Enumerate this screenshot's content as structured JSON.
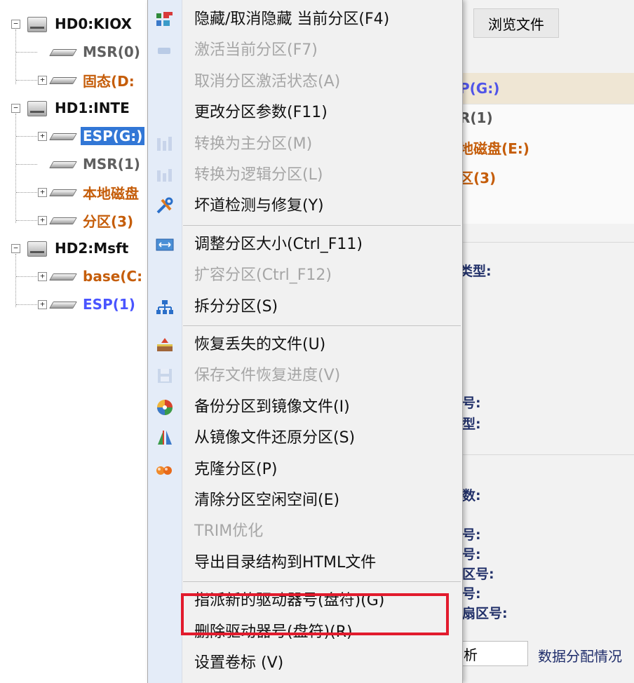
{
  "tree": {
    "nodes": [
      {
        "label": "HD0:KIOX",
        "type": "disk",
        "expander": "−",
        "color": "black"
      },
      {
        "label": "MSR(0)",
        "type": "partition",
        "color": "gray"
      },
      {
        "label": "固态(D:",
        "type": "partition",
        "expander": "+",
        "color": "orange"
      },
      {
        "label": "HD1:INTE",
        "type": "disk",
        "expander": "−",
        "color": "black"
      },
      {
        "label": "ESP(G:)",
        "type": "partition",
        "expander": "+",
        "color": "selected"
      },
      {
        "label": "MSR(1)",
        "type": "partition",
        "color": "gray"
      },
      {
        "label": "本地磁盘",
        "type": "partition",
        "expander": "+",
        "color": "orange"
      },
      {
        "label": "分区(3)",
        "type": "partition",
        "expander": "+",
        "color": "orange"
      },
      {
        "label": "HD2:Msft",
        "type": "disk",
        "expander": "−",
        "color": "black"
      },
      {
        "label": "base(C:",
        "type": "partition",
        "expander": "+",
        "color": "orange"
      },
      {
        "label": "ESP(1)",
        "type": "partition",
        "expander": "+",
        "color": "blue"
      }
    ]
  },
  "right_panel": {
    "tab_label": "浏览文件",
    "rows": [
      {
        "label": "P(G:)",
        "color": "#5054e8"
      },
      {
        "label": "R(1)",
        "color": "#555555"
      },
      {
        "label": "地磁盘(E:)",
        "color": "#c55d0a"
      },
      {
        "label": "区(3)",
        "color": "#c55d0a"
      }
    ],
    "fields": [
      "类型:",
      "号:",
      "型:",
      "数:",
      "号:",
      "号:",
      "区号:",
      "号:",
      "扇区号:"
    ],
    "input_value": "析",
    "trailing_text": "数据分配情况"
  },
  "context_menu": {
    "items": [
      {
        "label": "隐藏/取消隐藏 当前分区(F4)",
        "icon": "hide-partition-icon",
        "enabled": true
      },
      {
        "label": "激活当前分区(F7)",
        "icon": "activate-partition-icon",
        "enabled": false
      },
      {
        "label": "取消分区激活状态(A)",
        "icon": "",
        "enabled": false
      },
      {
        "label": "更改分区参数(F11)",
        "icon": "",
        "enabled": true
      },
      {
        "label": "转换为主分区(M)",
        "icon": "convert-primary-icon",
        "enabled": false
      },
      {
        "label": "转换为逻辑分区(L)",
        "icon": "convert-logical-icon",
        "enabled": false
      },
      {
        "label": "坏道检测与修复(Y)",
        "icon": "repair-tools-icon",
        "enabled": true
      },
      {
        "separator": true
      },
      {
        "label": "调整分区大小(Ctrl_F11)",
        "icon": "resize-partition-icon",
        "enabled": true
      },
      {
        "label": "扩容分区(Ctrl_F12)",
        "icon": "",
        "enabled": false
      },
      {
        "label": "拆分分区(S)",
        "icon": "split-partition-icon",
        "enabled": true
      },
      {
        "separator": true
      },
      {
        "label": "恢复丢失的文件(U)",
        "icon": "recover-files-icon",
        "enabled": true
      },
      {
        "label": "保存文件恢复进度(V)",
        "icon": "save-progress-icon",
        "enabled": false
      },
      {
        "label": "备份分区到镜像文件(I)",
        "icon": "backup-image-icon",
        "enabled": true
      },
      {
        "label": "从镜像文件还原分区(S)",
        "icon": "restore-image-icon",
        "enabled": true
      },
      {
        "label": "克隆分区(P)",
        "icon": "clone-partition-icon",
        "enabled": true
      },
      {
        "label": "清除分区空闲空间(E)",
        "icon": "",
        "enabled": true
      },
      {
        "label": "TRIM优化",
        "icon": "",
        "enabled": false
      },
      {
        "label": "导出目录结构到HTML文件",
        "icon": "",
        "enabled": true
      },
      {
        "separator": true
      },
      {
        "label": "指派新的驱动器号(盘符)(G)",
        "icon": "",
        "enabled": true,
        "highlighted": true
      },
      {
        "label": "删除驱动器号(盘符)(R)",
        "icon": "",
        "enabled": true
      },
      {
        "label": "设置卷标 (V)",
        "icon": "",
        "enabled": true
      }
    ]
  },
  "colors": {
    "selection": "#3277d6",
    "highlight_box": "#e21b2d",
    "disabled_text": "#a6a6a6",
    "orange_partition": "#c55d0a",
    "blue_partition": "#4a55ff"
  }
}
